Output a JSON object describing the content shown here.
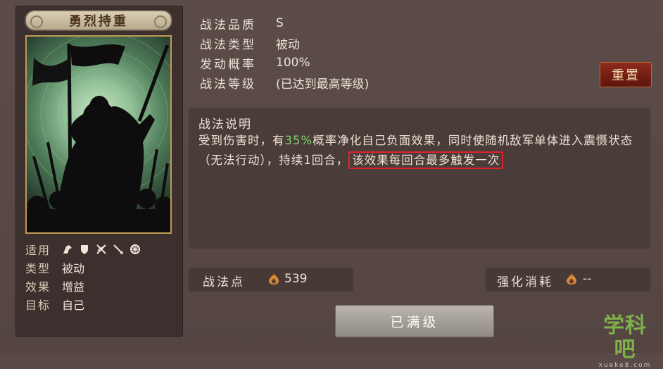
{
  "skill_name": "勇烈持重",
  "meta": {
    "apply_label": "适用",
    "type_label": "类型",
    "type_value": "被动",
    "effect_label": "效果",
    "effect_value": "增益",
    "target_label": "目标",
    "target_value": "自己",
    "apply_icons": [
      "cavalry-icon",
      "shield-icon",
      "bow-icon",
      "spear-icon",
      "chariot-wheel-icon"
    ]
  },
  "info": {
    "quality_label": "战法品质",
    "quality_value": "S",
    "kind_label": "战法类型",
    "kind_value": "被动",
    "rate_label": "发动概率",
    "rate_value": "100%",
    "level_label": "战法等级",
    "level_value": "(已达到最高等级)"
  },
  "reset_button": "重置",
  "description": {
    "title": "战法说明",
    "part1": "受到伤害时，有",
    "pct": "35%",
    "part2": "概率净化自己负面效果，同时使随机敌军单体进入震慑状态（无法行动），持续1回合，",
    "highlighted": "该效果每回合最多触发一次"
  },
  "points": {
    "label": "战法点",
    "value": "539"
  },
  "upgrade_cost": {
    "label": "强化消耗",
    "value": "--"
  },
  "maxed_button": "已满级",
  "watermark": {
    "main": "学科吧",
    "sub": "xueke8.com"
  },
  "colors": {
    "accent_green": "#7fcf6e",
    "highlight_border": "#e0232b",
    "reset_button": "#8d2b1c"
  }
}
